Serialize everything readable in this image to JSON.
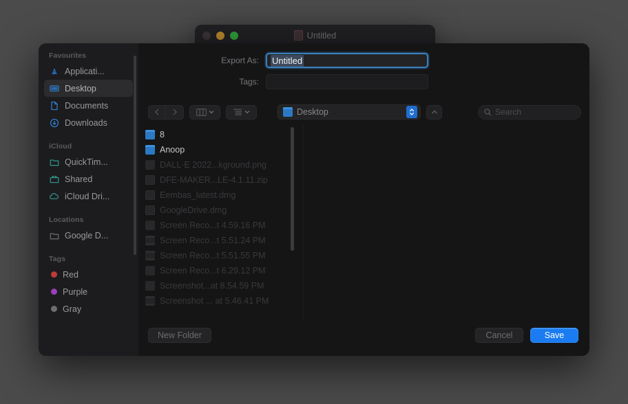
{
  "background_window": {
    "title": "Untitled",
    "traffic_lights": [
      "close-red",
      "minimize-amber",
      "zoom-green"
    ]
  },
  "sheet": {
    "form": {
      "export_as_label": "Export As:",
      "export_as_value": "Untitled",
      "tags_label": "Tags:",
      "tags_value": ""
    },
    "toolbar": {
      "back_icon": "chevron-left",
      "forward_icon": "chevron-right",
      "view_icon": "column-view",
      "group_icon": "list-view",
      "location_label": "Desktop",
      "up_icon": "chevron-up",
      "search_placeholder": "Search"
    },
    "sidebar": {
      "sections": [
        {
          "title": "Favourites",
          "items": [
            {
              "label": "Applicati...",
              "icon": "applications-icon",
              "selected": false
            },
            {
              "label": "Desktop",
              "icon": "desktop-icon",
              "selected": true
            },
            {
              "label": "Documents",
              "icon": "documents-icon",
              "selected": false
            },
            {
              "label": "Downloads",
              "icon": "downloads-icon",
              "selected": false
            }
          ]
        },
        {
          "title": "iCloud",
          "items": [
            {
              "label": "QuickTim...",
              "icon": "folder-icon",
              "selected": false
            },
            {
              "label": "Shared",
              "icon": "shared-folder-icon",
              "selected": false
            },
            {
              "label": "iCloud Dri...",
              "icon": "icloud-icon",
              "selected": false
            }
          ]
        },
        {
          "title": "Locations",
          "items": [
            {
              "label": "Google D...",
              "icon": "drive-icon",
              "selected": false
            }
          ]
        },
        {
          "title": "Tags",
          "items": [
            {
              "label": "Red",
              "icon": "tag-dot",
              "color": "#bf3a3a",
              "selected": false
            },
            {
              "label": "Purple",
              "icon": "tag-dot",
              "color": "#9b3fb8",
              "selected": false
            },
            {
              "label": "Gray",
              "icon": "tag-dot",
              "color": "#6e6e70",
              "selected": false
            }
          ]
        }
      ]
    },
    "files": [
      {
        "name": "8",
        "icon": "folder",
        "enabled": true,
        "chevron": true
      },
      {
        "name": "Anoop",
        "icon": "folder",
        "enabled": true,
        "chevron": true
      },
      {
        "name": "DALL·E 2022...kground.png",
        "icon": "image",
        "enabled": false,
        "chevron": false
      },
      {
        "name": "DFE-MAKER...LE-4.1.11.zip",
        "icon": "doc",
        "enabled": false,
        "chevron": false
      },
      {
        "name": "Eembas_latest.dmg",
        "icon": "doc",
        "enabled": false,
        "chevron": false
      },
      {
        "name": "GoogleDrive.dmg",
        "icon": "doc",
        "enabled": false,
        "chevron": false
      },
      {
        "name": "Screen Reco...t 4.59.16 PM",
        "icon": "image",
        "enabled": false,
        "chevron": false
      },
      {
        "name": "Screen Reco...t 5.51.24 PM",
        "icon": "movie",
        "enabled": false,
        "chevron": false
      },
      {
        "name": "Screen Reco...t 5.51.55 PM",
        "icon": "movie",
        "enabled": false,
        "chevron": false
      },
      {
        "name": "Screen Reco...t 6.29.12 PM",
        "icon": "image",
        "enabled": false,
        "chevron": false
      },
      {
        "name": "Screenshot...at 8.54.59 PM",
        "icon": "image",
        "enabled": false,
        "chevron": false
      },
      {
        "name": "Screenshot ... at 5.46.41 PM",
        "icon": "movie",
        "enabled": false,
        "chevron": false
      }
    ],
    "footer": {
      "new_folder_label": "New Folder",
      "cancel_label": "Cancel",
      "save_label": "Save"
    }
  },
  "colors": {
    "accent_blue": "#1a7cf0",
    "focus_ring": "#3c7fb8",
    "folder_blue": "#2b79c4",
    "sheet_bg": "#141415",
    "sidebar_bg": "#1c1c1e",
    "backdrop": "#4b4b4b"
  }
}
